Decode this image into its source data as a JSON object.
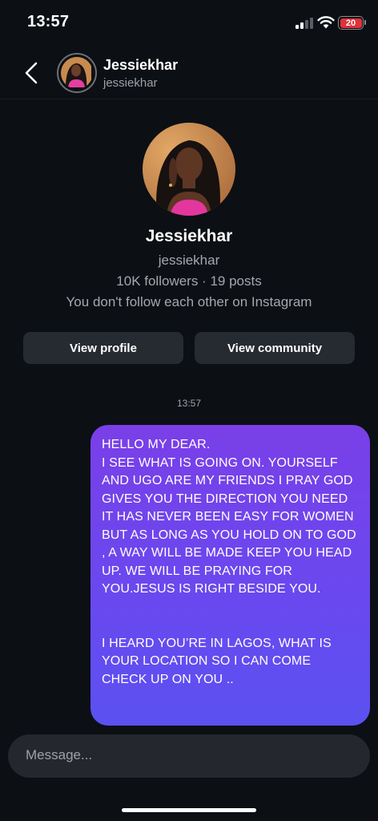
{
  "status_bar": {
    "time": "13:57",
    "battery_level": "20",
    "battery_color": "#e0323a",
    "icons": [
      "signal-icon",
      "wifi-icon",
      "battery-icon"
    ]
  },
  "header": {
    "display_name": "Jessiekhar",
    "username": "jessiekhar",
    "back_icon": "chevron-left-icon"
  },
  "profile": {
    "display_name": "Jessiekhar",
    "username": "jessiekhar",
    "stats": "10K followers · 19 posts",
    "follow_status": "You don't follow each other on Instagram",
    "view_profile_label": "View profile",
    "view_community_label": "View community"
  },
  "conversation": {
    "timestamp": "13:57",
    "messages": [
      {
        "sender": "me",
        "paragraphs": [
          "HELLO MY DEAR.",
          "I SEE WHAT IS GOING ON. YOURSELF AND UGO ARE MY FRIENDS I PRAY GOD GIVES YOU THE DIRECTION YOU NEED IT HAS NEVER BEEN EASY FOR WOMEN BUT AS LONG AS YOU HOLD ON TO GOD , A WAY WILL BE MADE KEEP YOU HEAD UP. WE WILL BE PRAYING FOR YOU.JESUS IS RIGHT BESIDE YOU.",
          "I HEARD YOU’RE IN LAGOS, WHAT IS YOUR LOCATION SO I CAN COME CHECK UP ON YOU .."
        ]
      }
    ]
  },
  "composer": {
    "placeholder": "Message..."
  },
  "colors": {
    "background": "#0c0f14",
    "bubble_gradient_top": "#7a3fe8",
    "bubble_gradient_bottom": "#5b51f0",
    "button_bg": "#262a31"
  }
}
